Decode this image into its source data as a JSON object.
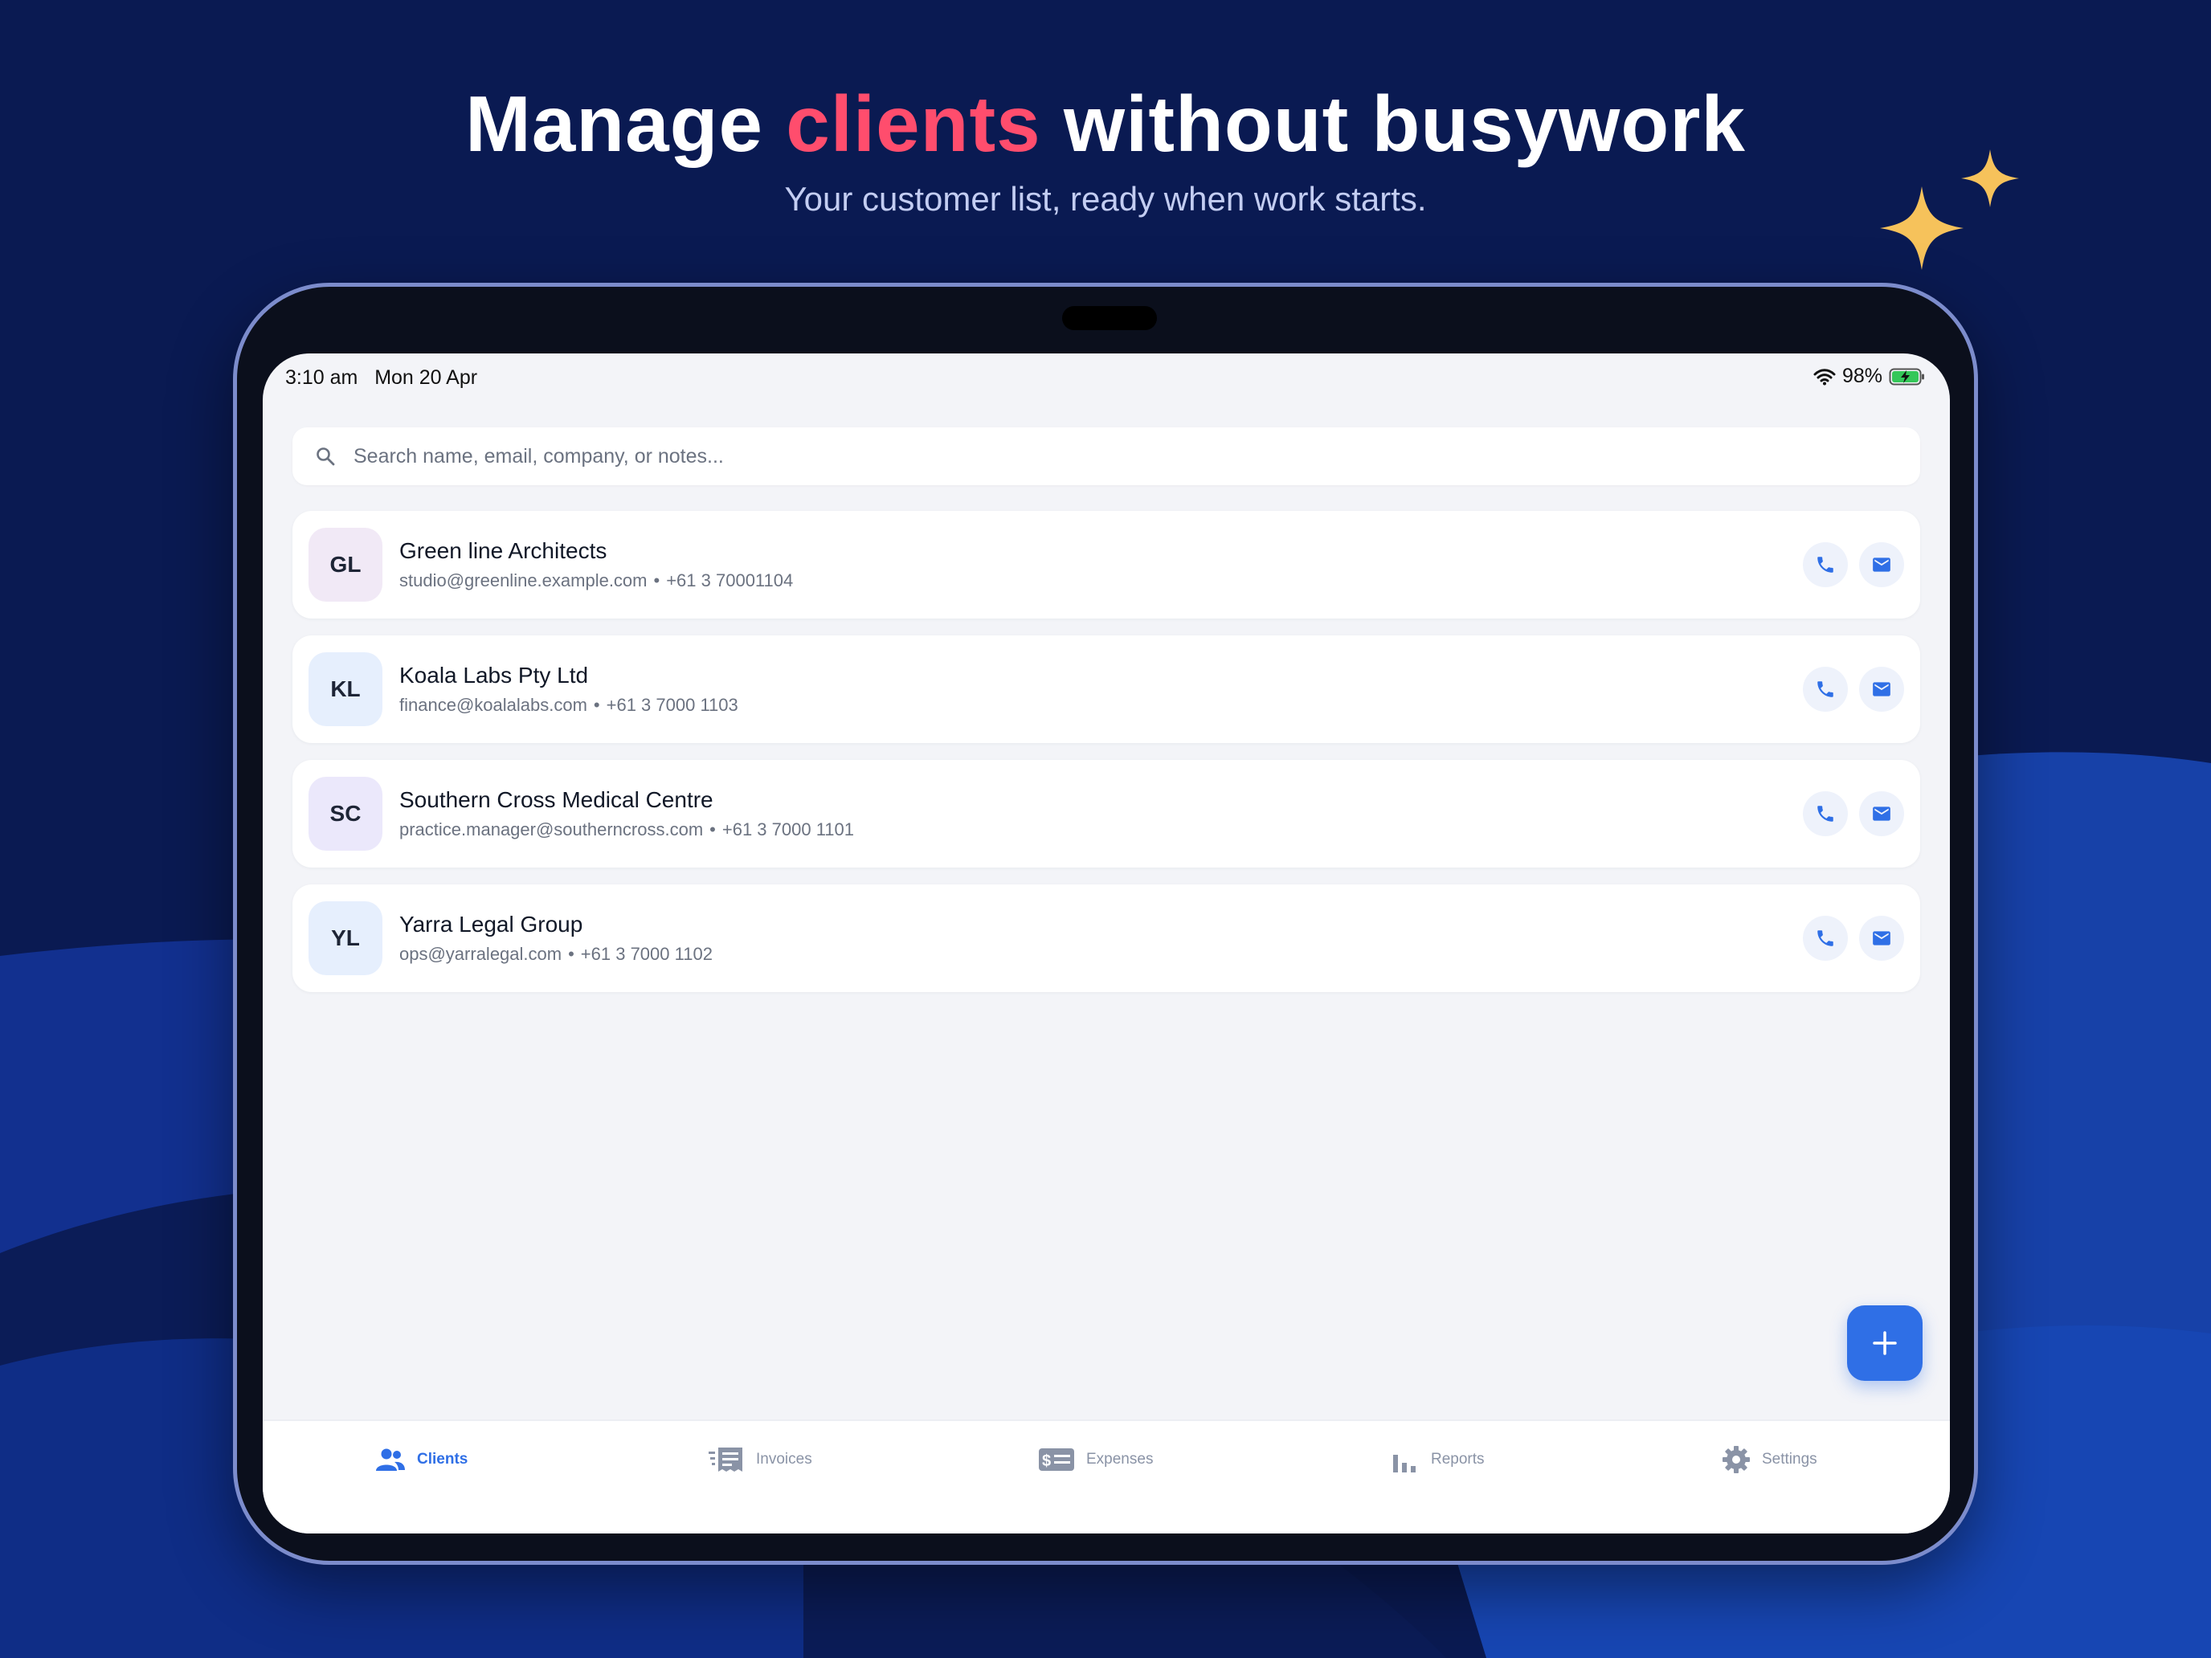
{
  "hero": {
    "headline_part1": "Manage",
    "headline_accent": "clients",
    "headline_part2": "without busywork",
    "subtitle": "Your customer list, ready when work starts."
  },
  "status_bar": {
    "time": "3:10 am",
    "date": "Mon 20 Apr",
    "battery": "98%"
  },
  "search": {
    "placeholder": "Search name, email, company, or notes..."
  },
  "clients": [
    {
      "initials": "GL",
      "name": "Green line Architects",
      "email": "studio@greenline.example.com",
      "phone": "+61 3 70001104"
    },
    {
      "initials": "KL",
      "name": "Koala Labs Pty Ltd",
      "email": "finance@koalalabs.com",
      "phone": "+61 3 7000 1103"
    },
    {
      "initials": "SC",
      "name": "Southern Cross Medical Centre",
      "email": "practice.manager@southerncross.com",
      "phone": "+61 3 7000 1101"
    },
    {
      "initials": "YL",
      "name": "Yarra Legal Group",
      "email": "ops@yarralegal.com",
      "phone": "+61 3 7000 1102"
    }
  ],
  "separator": "•",
  "tabs": [
    {
      "label": "Clients",
      "icon": "people-icon",
      "active": true
    },
    {
      "label": "Invoices",
      "icon": "receipt-icon",
      "active": false
    },
    {
      "label": "Expenses",
      "icon": "money-icon",
      "active": false
    },
    {
      "label": "Reports",
      "icon": "bar-chart-icon",
      "active": false
    },
    {
      "label": "Settings",
      "icon": "gear-icon",
      "active": false
    }
  ],
  "colors": {
    "accent": "#2f6fe6",
    "headline_accent": "#ff4d6d",
    "background": "#0a1a52",
    "sparkle": "#f6c25b"
  }
}
